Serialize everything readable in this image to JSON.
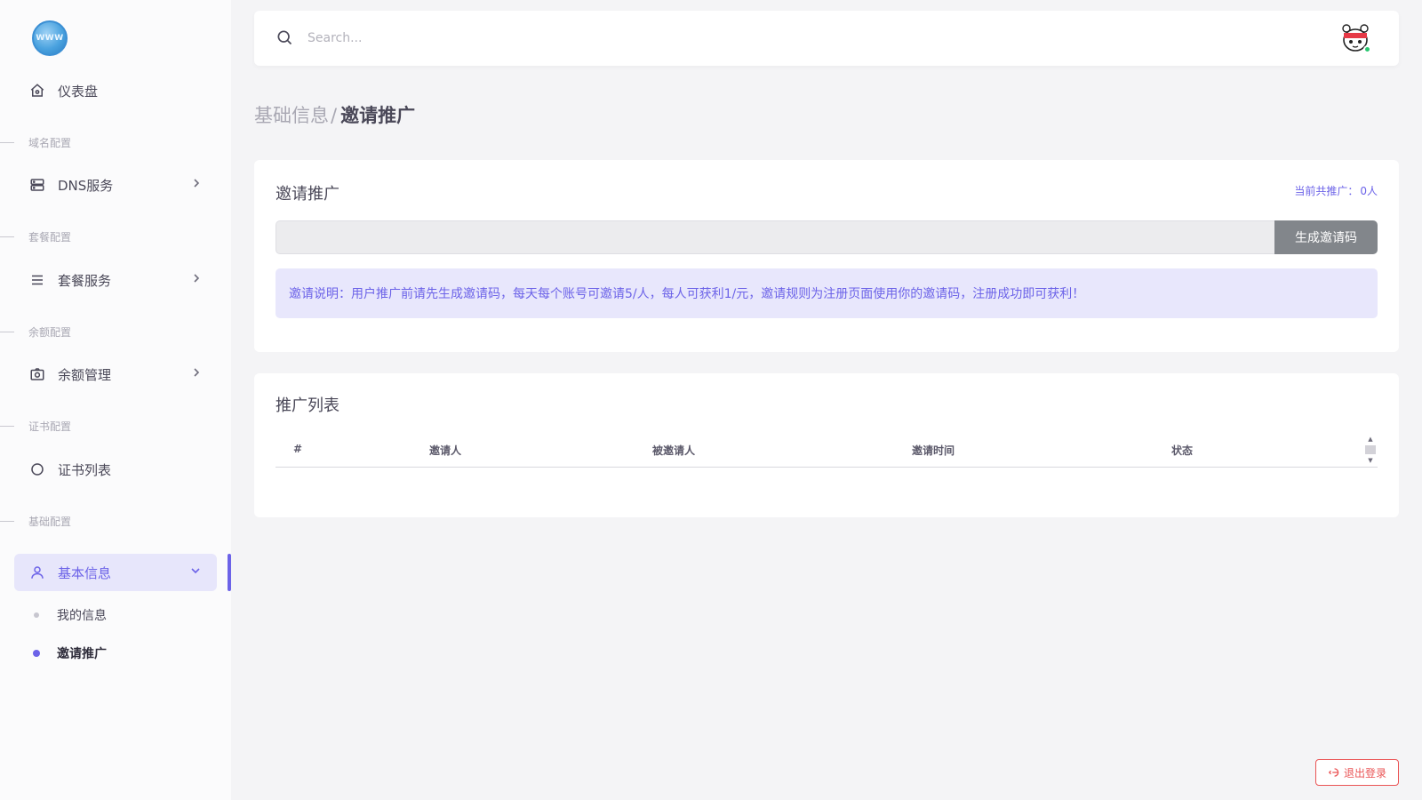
{
  "logo": {
    "text": "WWW"
  },
  "sidebar": {
    "dashboard": "仪表盘",
    "sections": {
      "domain": "域名配置",
      "plan": "套餐配置",
      "balance": "余额配置",
      "cert": "证书配置",
      "basic": "基础配置"
    },
    "items": {
      "dns": "DNS服务",
      "plan": "套餐服务",
      "balance": "余额管理",
      "cert": "证书列表",
      "basic_info": "基本信息"
    },
    "sub_items": {
      "my_info": "我的信息",
      "invite": "邀请推广"
    }
  },
  "topbar": {
    "search_placeholder": "Search..."
  },
  "breadcrumb": {
    "parent": "基础信息",
    "separator": "/",
    "current": "邀请推广"
  },
  "invite_card": {
    "title": "邀请推广",
    "count_label": "当前共推广：",
    "count_value": "0人",
    "code_value": "",
    "generate_button": "生成邀请码",
    "notice": "邀请说明：用户推广前请先生成邀请码，每天每个账号可邀请5/人，每人可获利1/元，邀请规则为注册页面使用你的邀请码，注册成功即可获利！"
  },
  "list_card": {
    "title": "推广列表",
    "columns": [
      "#",
      "邀请人",
      "被邀请人",
      "邀请时间",
      "状态"
    ]
  },
  "logout": {
    "label": "退出登录"
  },
  "colors": {
    "accent": "#6c63e8",
    "danger": "#ea5455",
    "online": "#28c76f",
    "button_gray": "#82868b"
  }
}
